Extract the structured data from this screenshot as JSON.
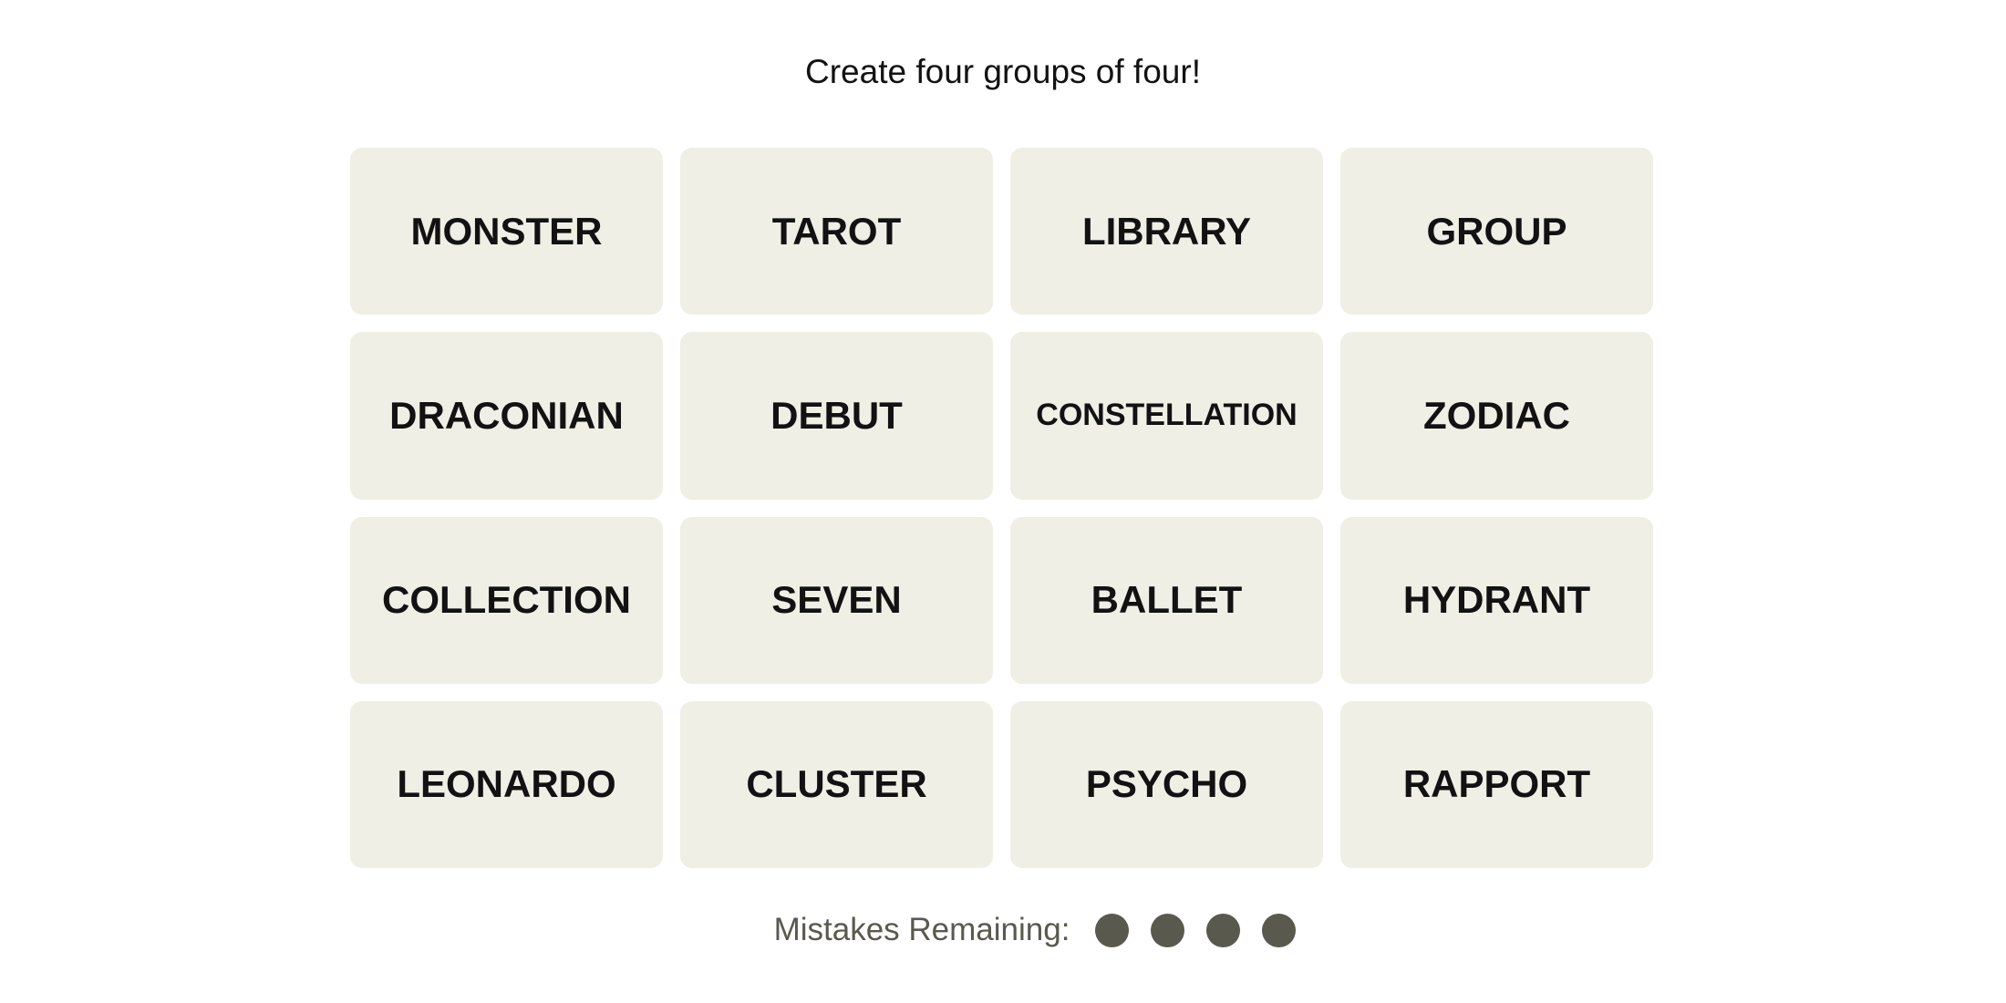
{
  "header": {
    "instructions": "Create four groups of four!"
  },
  "board": {
    "tiles": [
      {
        "label": "MONSTER",
        "selected": false
      },
      {
        "label": "TAROT",
        "selected": false
      },
      {
        "label": "LIBRARY",
        "selected": false
      },
      {
        "label": "GROUP",
        "selected": false
      },
      {
        "label": "DRACONIAN",
        "selected": false
      },
      {
        "label": "DEBUT",
        "selected": false
      },
      {
        "label": "CONSTELLATION",
        "selected": false
      },
      {
        "label": "ZODIAC",
        "selected": false
      },
      {
        "label": "COLLECTION",
        "selected": false
      },
      {
        "label": "SEVEN",
        "selected": false
      },
      {
        "label": "BALLET",
        "selected": false
      },
      {
        "label": "HYDRANT",
        "selected": false
      },
      {
        "label": "LEONARDO",
        "selected": false
      },
      {
        "label": "CLUSTER",
        "selected": false
      },
      {
        "label": "PSYCHO",
        "selected": false
      },
      {
        "label": "RAPPORT",
        "selected": false
      }
    ]
  },
  "mistakes": {
    "label": "Mistakes Remaining:",
    "remaining": 4,
    "total": 4,
    "dot_color": "#5a594e"
  },
  "colors": {
    "tile_background": "#efefe6",
    "tile_text": "#121212",
    "page_background": "#ffffff"
  }
}
